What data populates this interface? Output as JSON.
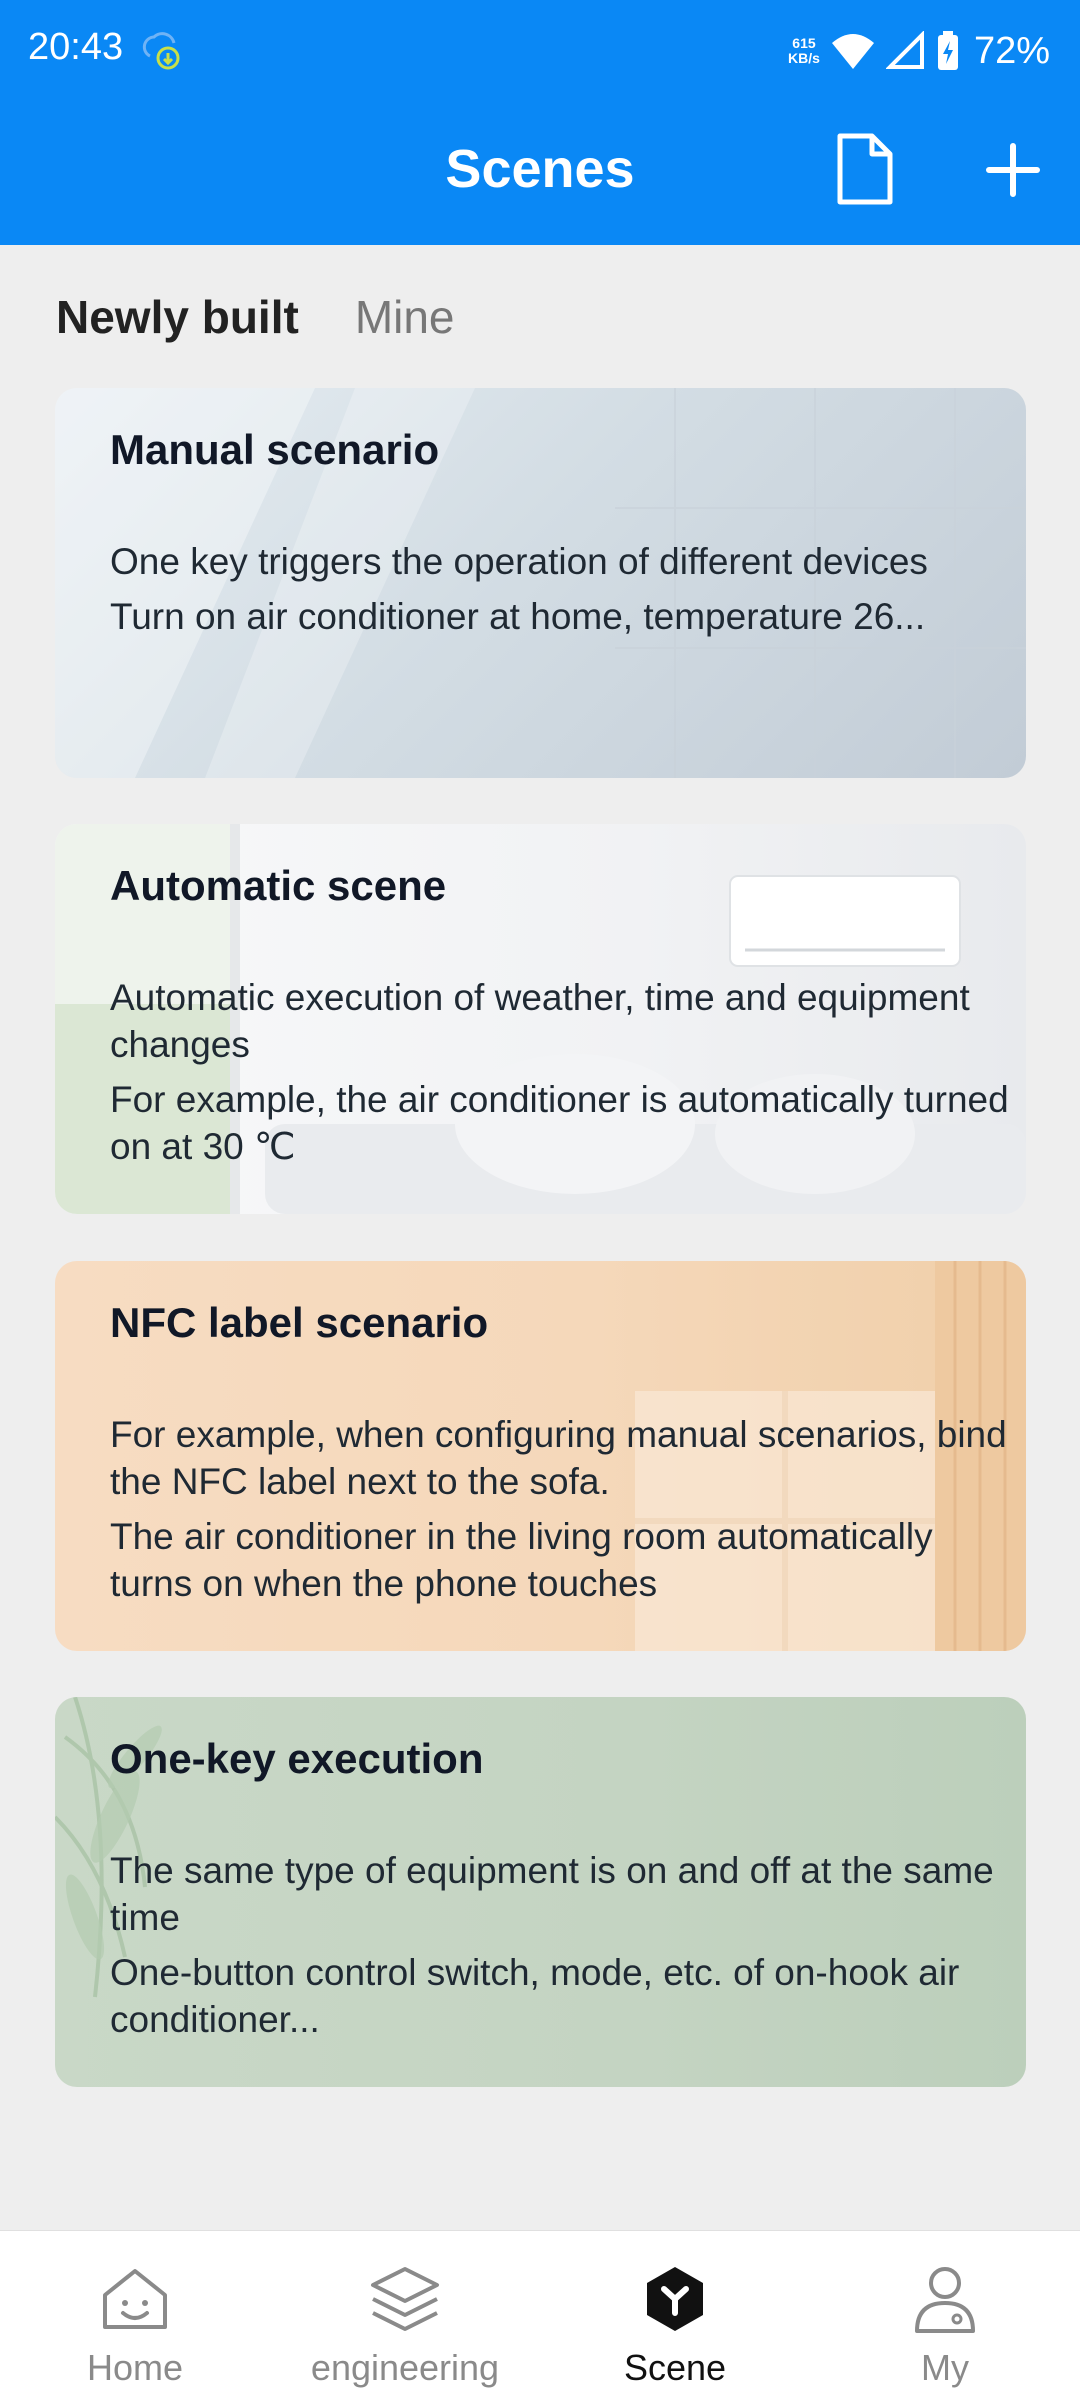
{
  "status_bar": {
    "time": "20:43",
    "net_speed_value": "615",
    "net_speed_unit": "KB/s",
    "battery": "72%"
  },
  "header": {
    "title": "Scenes"
  },
  "tabs": [
    {
      "label": "Newly built",
      "active": true
    },
    {
      "label": "Mine",
      "active": false
    }
  ],
  "cards": [
    {
      "title": "Manual scenario",
      "lines": [
        "One key triggers the operation of different devices",
        "Turn on air conditioner at home, temperature 26..."
      ]
    },
    {
      "title": "Automatic scene",
      "lines": [
        "Automatic execution of weather, time and equipment changes",
        "For example, the air conditioner is automatically turned on at 30 ℃"
      ]
    },
    {
      "title": "NFC label scenario",
      "lines": [
        "For example, when configuring manual scenarios, bind the NFC label next to the sofa.",
        "The air conditioner in the living room automatically turns on when the phone touches"
      ]
    },
    {
      "title": "One-key execution",
      "lines": [
        "The same type of equipment is on and off at the same time",
        "One-button control switch, mode, etc. of on-hook air conditioner..."
      ]
    }
  ],
  "bottom_nav": [
    {
      "label": "Home",
      "icon": "home-icon",
      "active": false
    },
    {
      "label": "engineering",
      "icon": "layers-icon",
      "active": false
    },
    {
      "label": "Scene",
      "icon": "scene-icon",
      "active": true
    },
    {
      "label": "My",
      "icon": "person-icon",
      "active": false
    }
  ],
  "colors": {
    "header_bg": "#0A88F5",
    "page_bg": "#EEEEEE",
    "active_text": "#111111",
    "inactive_text": "#8A8A8A"
  }
}
